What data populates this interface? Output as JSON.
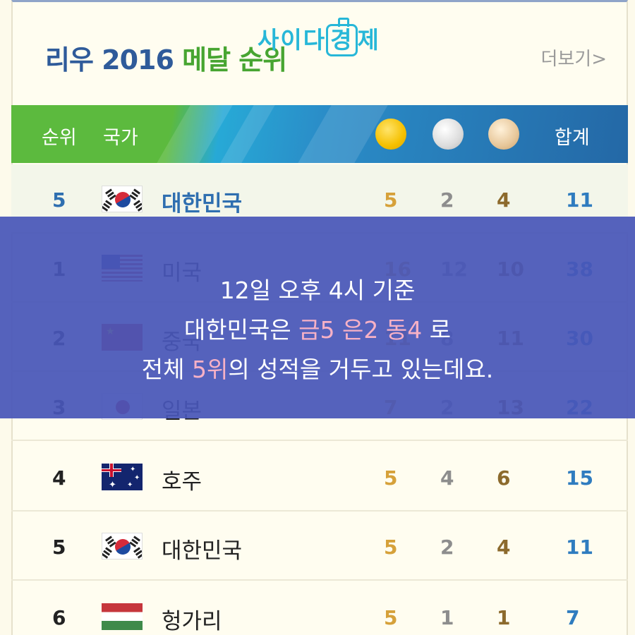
{
  "title": {
    "part1": "리우 2016",
    "part2": "메달 순위"
  },
  "watermark": {
    "a": "사",
    "b": "이",
    "c": "다",
    "bottle": "경",
    "d": "제"
  },
  "more_link": "더보기>",
  "header": {
    "rank": "순위",
    "country": "국가",
    "total": "합계"
  },
  "medal_icons": [
    "gold-medal-icon",
    "silver-medal-icon",
    "bronze-medal-icon"
  ],
  "colors": {
    "header_green": "#5cba3e",
    "header_blue": "#2468a6",
    "overlay": "#4856b8",
    "highlight_text": "#f7b1c6"
  },
  "rows": [
    {
      "rank": "5",
      "country": "대한민국",
      "flag": "korea-flag-icon",
      "gold": "5",
      "silver": "2",
      "bronze": "4",
      "total": "11",
      "highlight": true
    },
    {
      "rank": "1",
      "country": "미국",
      "flag": "usa-flag-icon",
      "gold": "16",
      "silver": "12",
      "bronze": "10",
      "total": "38"
    },
    {
      "rank": "2",
      "country": "중국",
      "flag": "china-flag-icon",
      "gold": "11",
      "silver": "8",
      "bronze": "11",
      "total": "30"
    },
    {
      "rank": "3",
      "country": "일본",
      "flag": "japan-flag-icon",
      "gold": "7",
      "silver": "2",
      "bronze": "13",
      "total": "22"
    },
    {
      "rank": "4",
      "country": "호주",
      "flag": "australia-flag-icon",
      "gold": "5",
      "silver": "4",
      "bronze": "6",
      "total": "15"
    },
    {
      "rank": "5",
      "country": "대한민국",
      "flag": "korea-flag-icon",
      "gold": "5",
      "silver": "2",
      "bronze": "4",
      "total": "11"
    },
    {
      "rank": "6",
      "country": "헝가리",
      "flag": "hungary-flag-icon",
      "gold": "5",
      "silver": "1",
      "bronze": "1",
      "total": "7"
    }
  ],
  "overlay": {
    "line1": "12일 오후 4시 기준",
    "line2_a": "대한민국은 ",
    "line2_gold": "금5",
    "line2_sp1": " ",
    "line2_silver": "은2",
    "line2_sp2": " ",
    "line2_bronze": "동4",
    "line2_b": " 로",
    "line3_a": "전체 ",
    "line3_rank": "5위",
    "line3_b": "의 성적을 거두고 있는데요."
  }
}
